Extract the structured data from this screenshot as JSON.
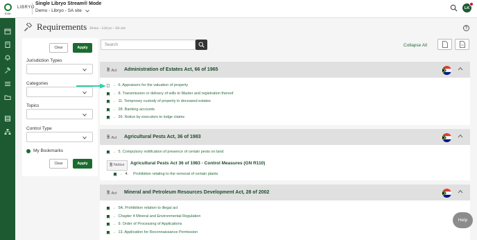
{
  "brand": {
    "logo_sub": "EXM",
    "name": "LIBRYO"
  },
  "header": {
    "mode_title": "Single Libryo Stream® Mode",
    "site": "Demo - Libryo - SA site",
    "avatar_initials": "LK"
  },
  "page": {
    "title": "Requirements",
    "crumb": "Demo - Libryo - SA site",
    "help": "?"
  },
  "filters": {
    "clear_label": "Clear",
    "apply_label": "Apply",
    "jurisdiction_label": "Jurisdiction Types",
    "categories_label": "Categories",
    "topics_label": "Topics",
    "control_label": "Control Type",
    "bookmarks_label": "My Bookmarks"
  },
  "search": {
    "placeholder": "Search"
  },
  "toolbar": {
    "collapse_all": "Collapse All"
  },
  "acts": [
    {
      "tag": "Act",
      "title": "Administration of Estates Act, 66 of 1965",
      "items": [
        "6. Appraisers for the valuation of property",
        "8. Transmission or delivery of wills to Master and registration thereof",
        "11. Temporary custody of property in deceased estates",
        "28. Banking accounts",
        "29. Notice by executors to lodge claims"
      ]
    },
    {
      "tag": "Act",
      "title": "Agricultural Pests Act, 36 of 1983",
      "items": [
        "5. Compulsory notification of presence of certain pests on land"
      ],
      "notice": {
        "tag": "Notice",
        "title": "Agricultural Pests Act 36 of 1983 - Control Measures (GN R110)",
        "item_num": "4.",
        "item_text": "Prohibition relating to the removal of certain plants"
      }
    },
    {
      "tag": "Act",
      "title": "Mineral and Petroleum Resources Development Act, 28 of 2002",
      "items": [
        "5A. Prohibition relation to illegal act",
        "Chapter 4 Mineral and Environmental Regulation",
        "9. Order of Processing of Applications",
        "13. Application for Reconnaissance Permission"
      ]
    }
  ],
  "help_bubble": "Help",
  "colors": {
    "nav_green": "#1d5a32",
    "apply_green": "#1b6b2f",
    "link_green": "#2b6a3e",
    "arrow_teal": "#2fd1a8"
  }
}
